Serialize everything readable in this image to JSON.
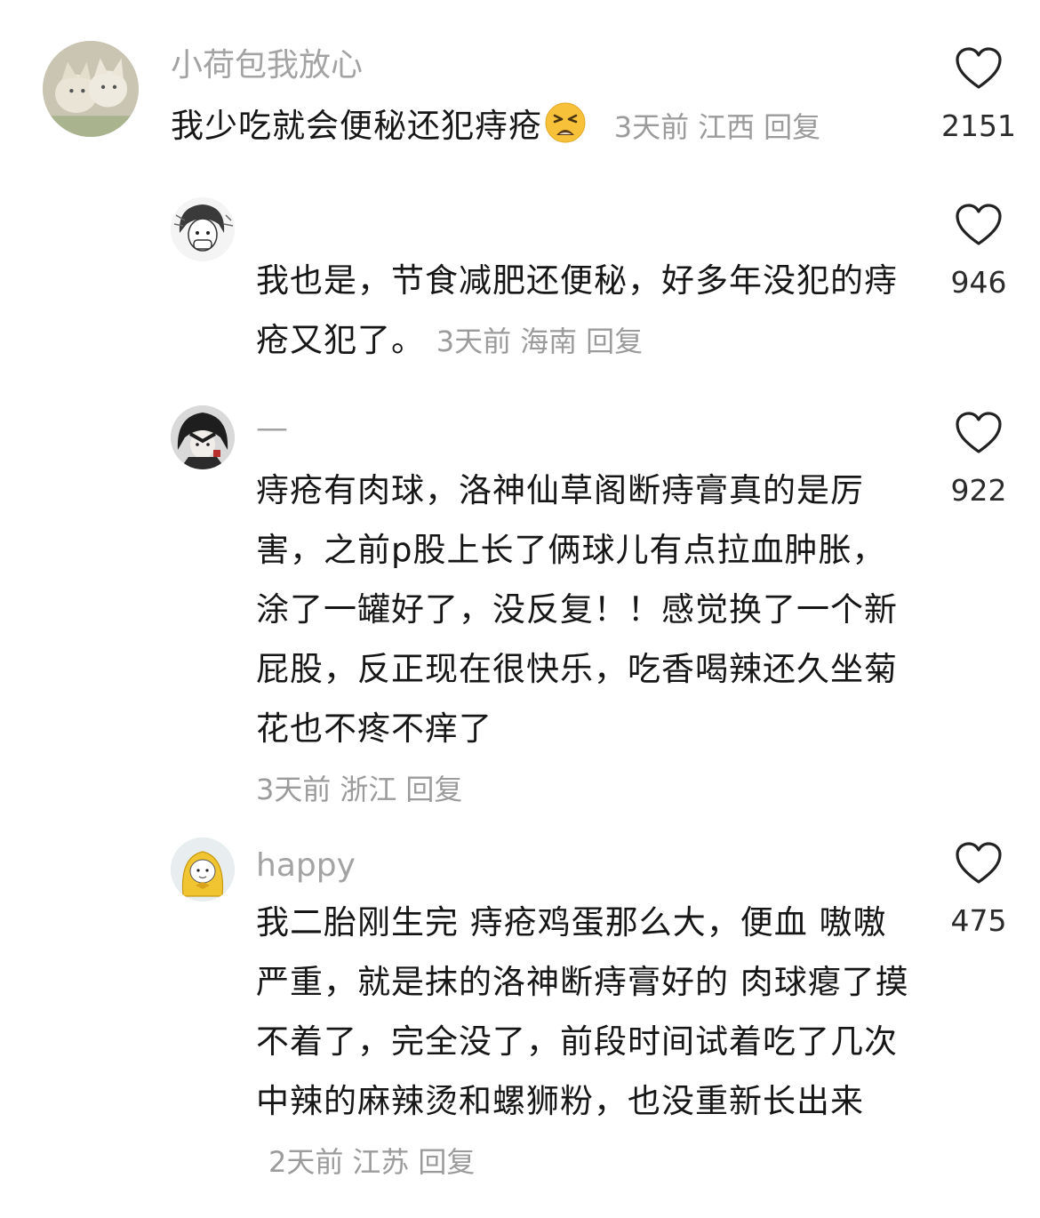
{
  "comments": [
    {
      "username": "小荷包我放心",
      "text": "我少吃就会便秘还犯痔疮",
      "emoji": "tired-face-emoji",
      "time": "3天前",
      "location": "江西",
      "reply_label": "回复",
      "likes": "2151"
    },
    {
      "username": "",
      "text": "我也是，节食减肥还便秘，好多年没犯的痔疮又犯了。",
      "time": "3天前",
      "location": "海南",
      "reply_label": "回复",
      "likes": "946"
    },
    {
      "username": "—",
      "text": "痔疮有肉球，洛神仙草阁断痔膏真的是厉害，之前p股上长了俩球儿有点拉血肿胀，涂了一罐好了，没反复！！感觉换了一个新屁股，反正现在很快乐，吃香喝辣还久坐菊花也不疼不痒了",
      "time": "3天前",
      "location": "浙江",
      "reply_label": "回复",
      "likes": "922"
    },
    {
      "username": "happy",
      "text": "我二胎刚生完 痔疮鸡蛋那么大，便血 嗷嗷严重，就是抹的洛神断痔膏好的 肉球瘪了摸不着了，完全没了，前段时间试着吃了几次中辣的麻辣烫和螺狮粉，也没重新长出来",
      "time": "2天前",
      "location": "江苏",
      "reply_label": "回复",
      "likes": "475"
    }
  ],
  "colors": {
    "meta_gray": "#9b9b9b",
    "username_gray": "#a3a3a3",
    "text_dark": "#161616"
  },
  "icons": {
    "like": "heart-outline-icon"
  }
}
